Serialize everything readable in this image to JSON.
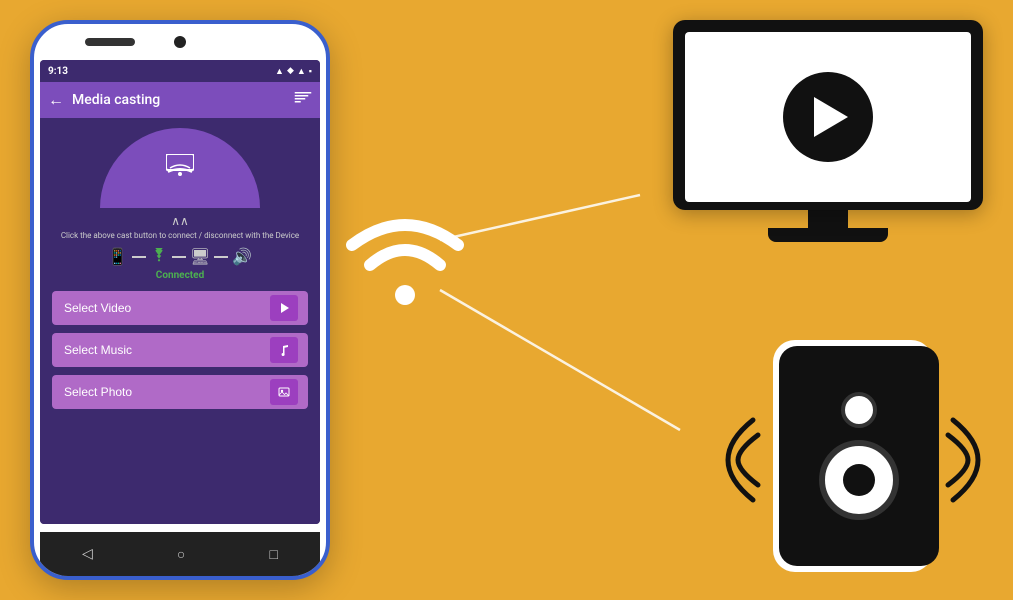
{
  "background_color": "#E8A830",
  "phone": {
    "status_bar": {
      "time": "9:13",
      "icons": [
        "▲",
        "◆",
        "▲",
        "▲",
        "▪"
      ]
    },
    "app_bar": {
      "title": "Media casting",
      "back_icon": "←",
      "cast_icon": "⬛"
    },
    "cast_hint": "Click the above cast button to connect / disconnect with the Device",
    "connection_status": "Connected",
    "buttons": [
      {
        "label": "Select Video",
        "icon": "▶"
      },
      {
        "label": "Select Music",
        "icon": "♪"
      },
      {
        "label": "Select Photo",
        "icon": "🖼"
      }
    ]
  },
  "icons": {
    "phone_icon": "📱",
    "wifi_icon": "wifi",
    "monitor_icon": "🖥",
    "speaker_icon": "🔊"
  }
}
